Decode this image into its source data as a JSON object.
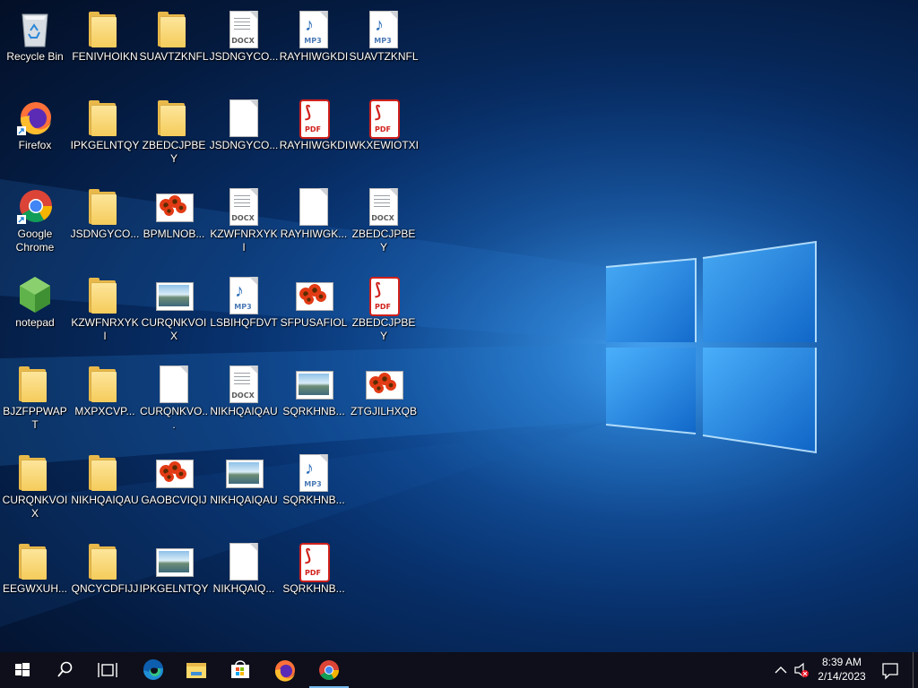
{
  "desktop": {
    "icons": [
      {
        "label": "Recycle Bin",
        "type": "recycle",
        "col": 0,
        "row": 0
      },
      {
        "label": "FENIVHOIKN",
        "type": "folder",
        "col": 1,
        "row": 0
      },
      {
        "label": "SUAVTZKNFL",
        "type": "folder",
        "col": 2,
        "row": 0
      },
      {
        "label": "JSDNGYCO...",
        "type": "docx",
        "col": 3,
        "row": 0
      },
      {
        "label": "RAYHIWGKDI",
        "type": "mp3",
        "col": 4,
        "row": 0
      },
      {
        "label": "SUAVTZKNFL",
        "type": "mp3",
        "col": 5,
        "row": 0
      },
      {
        "label": "Firefox",
        "type": "firefox",
        "col": 0,
        "row": 1
      },
      {
        "label": "IPKGELNTQY",
        "type": "folder",
        "col": 1,
        "row": 1
      },
      {
        "label": "ZBEDCJPBEY",
        "type": "folder",
        "col": 2,
        "row": 1
      },
      {
        "label": "JSDNGYCO...",
        "type": "blank",
        "col": 3,
        "row": 1
      },
      {
        "label": "RAYHIWGKDI",
        "type": "pdf",
        "col": 4,
        "row": 1
      },
      {
        "label": "WKXEWIOTXI",
        "type": "pdf",
        "col": 5,
        "row": 1
      },
      {
        "label": "Google Chrome",
        "type": "chrome",
        "col": 0,
        "row": 2
      },
      {
        "label": "JSDNGYCO...",
        "type": "folder",
        "col": 1,
        "row": 2
      },
      {
        "label": "BPMLNOB...",
        "type": "photo",
        "col": 2,
        "row": 2
      },
      {
        "label": "KZWFNRXYKI",
        "type": "docx",
        "col": 3,
        "row": 2
      },
      {
        "label": "RAYHIWGK...",
        "type": "blank",
        "col": 4,
        "row": 2
      },
      {
        "label": "ZBEDCJPBEY",
        "type": "docx",
        "col": 5,
        "row": 2
      },
      {
        "label": "notepad",
        "type": "notepad",
        "col": 0,
        "row": 3
      },
      {
        "label": "KZWFNRXYKI",
        "type": "folder",
        "col": 1,
        "row": 3
      },
      {
        "label": "CURQNKVOIX",
        "type": "picture",
        "col": 2,
        "row": 3
      },
      {
        "label": "LSBIHQFDVT",
        "type": "mp3",
        "col": 3,
        "row": 3
      },
      {
        "label": "SFPUSAFIOL",
        "type": "photo",
        "col": 4,
        "row": 3
      },
      {
        "label": "ZBEDCJPBEY",
        "type": "pdf",
        "col": 5,
        "row": 3
      },
      {
        "label": "BJZFPPWAPT",
        "type": "folder",
        "col": 0,
        "row": 4
      },
      {
        "label": "MXPXCVP...",
        "type": "folder",
        "col": 1,
        "row": 4
      },
      {
        "label": "CURQNKVO...",
        "type": "blank",
        "col": 2,
        "row": 4
      },
      {
        "label": "NIKHQAIQAU",
        "type": "docx",
        "col": 3,
        "row": 4
      },
      {
        "label": "SQRKHNB...",
        "type": "picture",
        "col": 4,
        "row": 4
      },
      {
        "label": "ZTGJILHXQB",
        "type": "photo",
        "col": 5,
        "row": 4
      },
      {
        "label": "CURQNKVOIX",
        "type": "folder",
        "col": 0,
        "row": 5
      },
      {
        "label": "NIKHQAIQAU",
        "type": "folder",
        "col": 1,
        "row": 5
      },
      {
        "label": "GAOBCVIQIJ",
        "type": "photo",
        "col": 2,
        "row": 5
      },
      {
        "label": "NIKHQAIQAU",
        "type": "picture",
        "col": 3,
        "row": 5
      },
      {
        "label": "SQRKHNB...",
        "type": "mp3",
        "col": 4,
        "row": 5
      },
      {
        "label": "EEGWXUH...",
        "type": "folder",
        "col": 0,
        "row": 6
      },
      {
        "label": "QNCYCDFIJJ",
        "type": "folder",
        "col": 1,
        "row": 6
      },
      {
        "label": "IPKGELNTQY",
        "type": "picture",
        "col": 2,
        "row": 6
      },
      {
        "label": "NIKHQAIQ...",
        "type": "blank",
        "col": 3,
        "row": 6
      },
      {
        "label": "SQRKHNB...",
        "type": "pdf",
        "col": 4,
        "row": 6
      }
    ],
    "tags": {
      "docx": "DOCX",
      "mp3": "MP3",
      "pdf": "PDF"
    }
  },
  "taskbar": {
    "buttons": [
      "start",
      "search",
      "task-view",
      "edge",
      "file-explorer",
      "store",
      "firefox",
      "chrome"
    ],
    "active": "chrome",
    "clock": {
      "time": "8:39 AM",
      "date": "2/14/2023"
    }
  },
  "colors": {
    "accent": "#76b9ed",
    "taskbar": "#0e0f1a",
    "folder": "#f5cc5b",
    "pdf": "#d0201b"
  }
}
